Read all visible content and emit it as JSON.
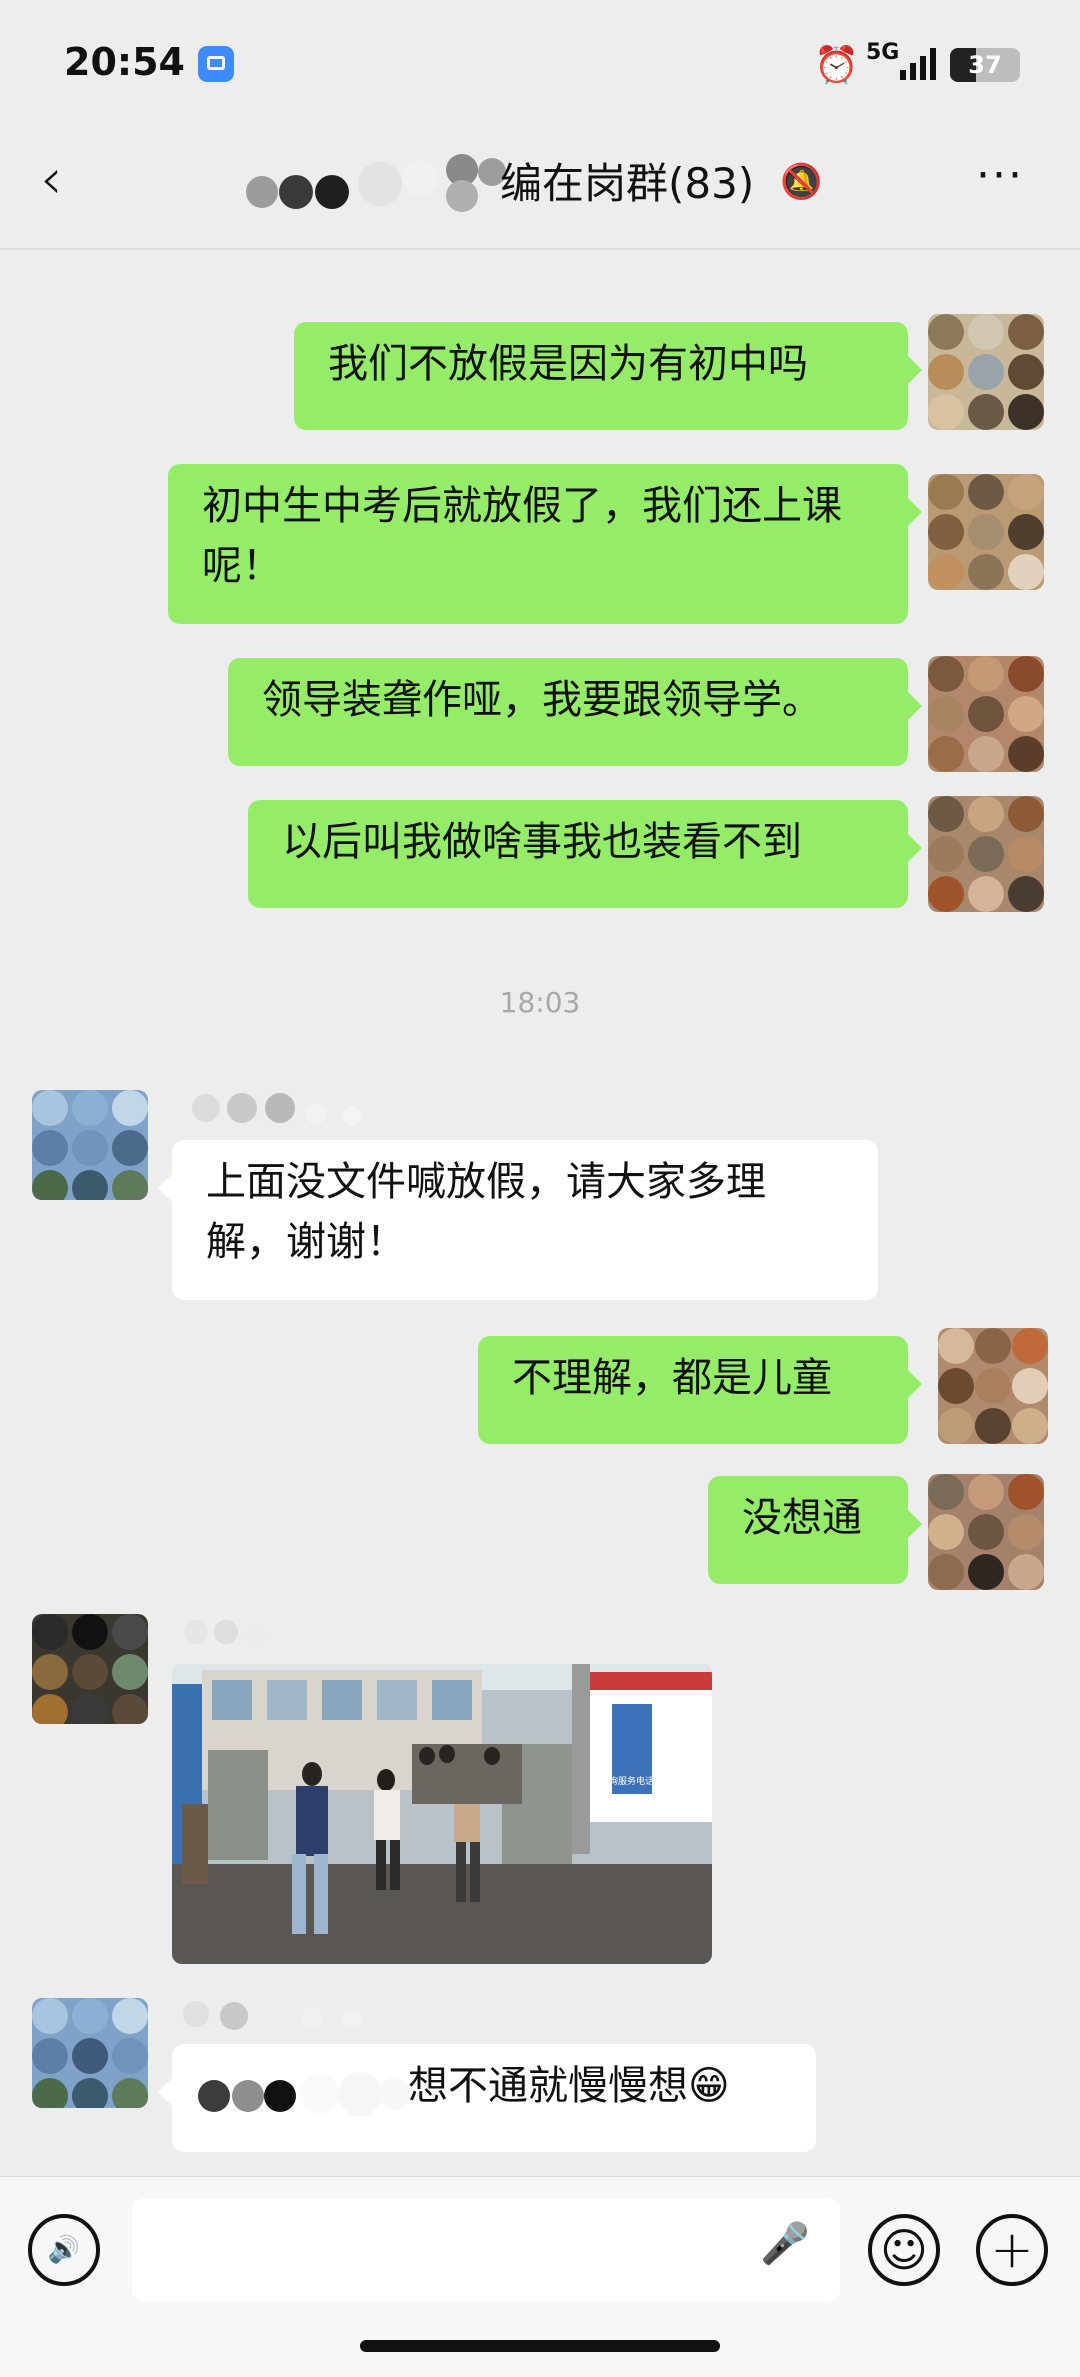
{
  "status_bar": {
    "time": "20:54",
    "network": "5G",
    "battery": "37",
    "icons": [
      "app-notification-icon",
      "alarm-icon",
      "signal-icon",
      "battery-icon"
    ]
  },
  "nav": {
    "back_icon": "‹",
    "title": "编在岗群(83)",
    "mute_icon": "🔕",
    "more_icon": "···"
  },
  "messages": [
    {
      "dir": "out",
      "text": "我们不放假是因为有初中吗"
    },
    {
      "dir": "out",
      "text": "初中生中考后就放假了，我们还上课呢！"
    },
    {
      "dir": "out",
      "text": "领导装聋作哑，我要跟领导学。"
    },
    {
      "dir": "out",
      "text": "以后叫我做啥事我也装看不到"
    },
    {
      "type": "timestamp",
      "text": "18:03"
    },
    {
      "dir": "in",
      "text": "上面没文件喊放假，请大家多理解，谢谢！"
    },
    {
      "dir": "out",
      "text": "不理解，都是儿童"
    },
    {
      "dir": "out",
      "text": "没想通"
    },
    {
      "dir": "in",
      "type": "image",
      "alt": "school-gate-photo"
    },
    {
      "dir": "in",
      "text": "想不通就慢慢想😁"
    }
  ],
  "photo_sign": {
    "phone_label": "咨询服务电话"
  },
  "input_bar": {
    "voice_icon": "🔊",
    "mic_icon": "🎤",
    "emoji_icon": "☺",
    "plus_icon": "+"
  },
  "colors": {
    "background": "#ededed",
    "outgoing_bubble": "#95ec69",
    "incoming_bubble": "#ffffff"
  }
}
